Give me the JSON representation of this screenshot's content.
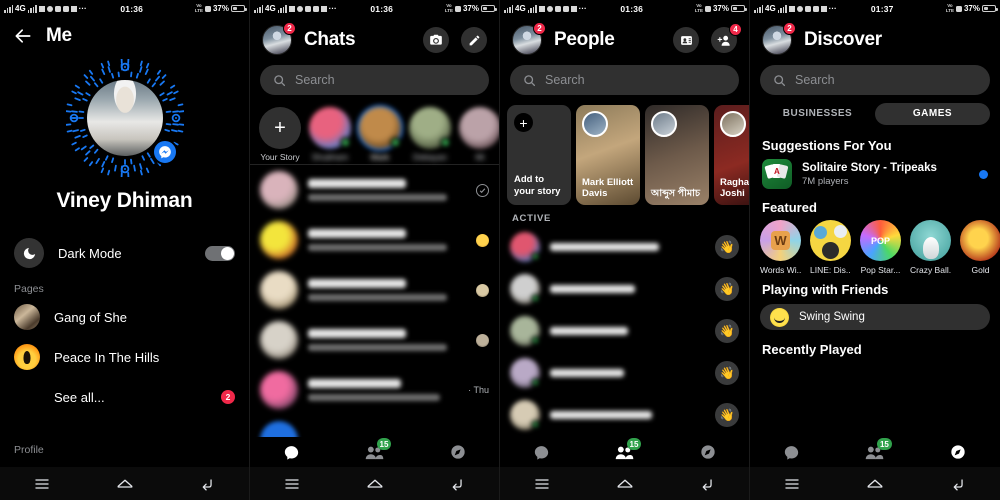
{
  "statusbar": {
    "network": "4G",
    "time_1": "01:36",
    "time_2": "01:36",
    "time_3": "01:36",
    "time_4": "01:37",
    "battery": "37%",
    "volte": "VoLTE"
  },
  "profile_screen": {
    "header_title": "Me",
    "back_icon": "back-arrow-icon",
    "user_name": "Viney Dhiman",
    "dark_mode_label": "Dark Mode",
    "dark_mode_on": true,
    "pages_section": "Pages",
    "pages": [
      {
        "name": "Gang of She"
      },
      {
        "name": "Peace In The Hills"
      }
    ],
    "see_all": "See all...",
    "see_all_badge": "2",
    "profile_section": "Profile"
  },
  "chats_screen": {
    "header_title": "Chats",
    "avatar_badge": "2",
    "camera_icon": "camera-icon",
    "compose_icon": "compose-pencil-icon",
    "search_placeholder": "Search",
    "stories": [
      {
        "name": "Your Story",
        "type": "add"
      },
      {
        "name": "Shubham",
        "active": true
      },
      {
        "name": "Mark",
        "active": true,
        "ring": true
      },
      {
        "name": "Debayan",
        "active": true
      },
      {
        "name": "Mi",
        "active": false
      }
    ],
    "chat_rows": [
      {
        "time": "",
        "right": "seen-check"
      },
      {
        "time": "",
        "right": "emoji-avatar"
      },
      {
        "time": "",
        "right": "mini-avatar"
      },
      {
        "time": "",
        "right": "mini-avatar"
      },
      {
        "time": "· Thu",
        "right": "time"
      }
    ],
    "tabs": [
      {
        "name": "chats-tab",
        "icon": "chat-bubble-icon",
        "active": true
      },
      {
        "name": "people-tab",
        "icon": "people-icon",
        "badge": "15",
        "active": false
      },
      {
        "name": "discover-tab",
        "icon": "compass-icon",
        "active": false
      }
    ]
  },
  "people_screen": {
    "header_title": "People",
    "avatar_badge": "2",
    "contacts_icon": "contact-card-icon",
    "add_person_icon": "add-person-icon",
    "add_person_badge": "4",
    "search_placeholder": "Search",
    "story_cards": [
      {
        "label": "Add to your story",
        "type": "add"
      },
      {
        "label": "Mark Elliott Davis"
      },
      {
        "label": "আব্দুস পীমাচ"
      },
      {
        "label": "Ragha Joshi"
      }
    ],
    "active_header": "ACTIVE",
    "active_rows": [
      {
        "wave": "wave-hand-icon"
      },
      {
        "wave": "wave-hand-icon"
      },
      {
        "wave": "wave-hand-icon"
      },
      {
        "wave": "wave-hand-icon"
      },
      {
        "wave": "wave-hand-icon"
      }
    ],
    "tabs": [
      {
        "name": "chats-tab",
        "icon": "chat-bubble-icon",
        "active": false
      },
      {
        "name": "people-tab",
        "icon": "people-icon",
        "badge": "15",
        "active": true
      },
      {
        "name": "discover-tab",
        "icon": "compass-icon",
        "active": false
      }
    ]
  },
  "discover_screen": {
    "header_title": "Discover",
    "avatar_badge": "2",
    "search_placeholder": "Search",
    "segment": [
      {
        "label": "BUSINESSES",
        "selected": false
      },
      {
        "label": "GAMES",
        "selected": true
      }
    ],
    "suggestions_title": "Suggestions For You",
    "suggestion": {
      "name": "Solitaire Story - Tripeaks",
      "players": "7M players"
    },
    "featured_title": "Featured",
    "featured": [
      {
        "label": "Words Wi..."
      },
      {
        "label": "LINE: Dis..."
      },
      {
        "label": "Pop Star..."
      },
      {
        "label": "Crazy Ball..."
      },
      {
        "label": "Gold"
      }
    ],
    "playing_title": "Playing with Friends",
    "playing_game": "Swing Swing",
    "recent_title": "Recently Played",
    "tabs": [
      {
        "name": "chats-tab",
        "icon": "chat-bubble-icon",
        "active": false
      },
      {
        "name": "people-tab",
        "icon": "people-icon",
        "badge": "15",
        "active": false
      },
      {
        "name": "discover-tab",
        "icon": "compass-icon",
        "active": true
      }
    ]
  },
  "android_nav": {
    "menu_icon": "menu-icon",
    "home_icon": "home-icon",
    "back_icon": "back-icon"
  },
  "colors": {
    "accent": "#1878f3",
    "badge_red": "#f02849",
    "badge_green": "#31a24c",
    "surface": "#303030",
    "background": "#000000"
  }
}
